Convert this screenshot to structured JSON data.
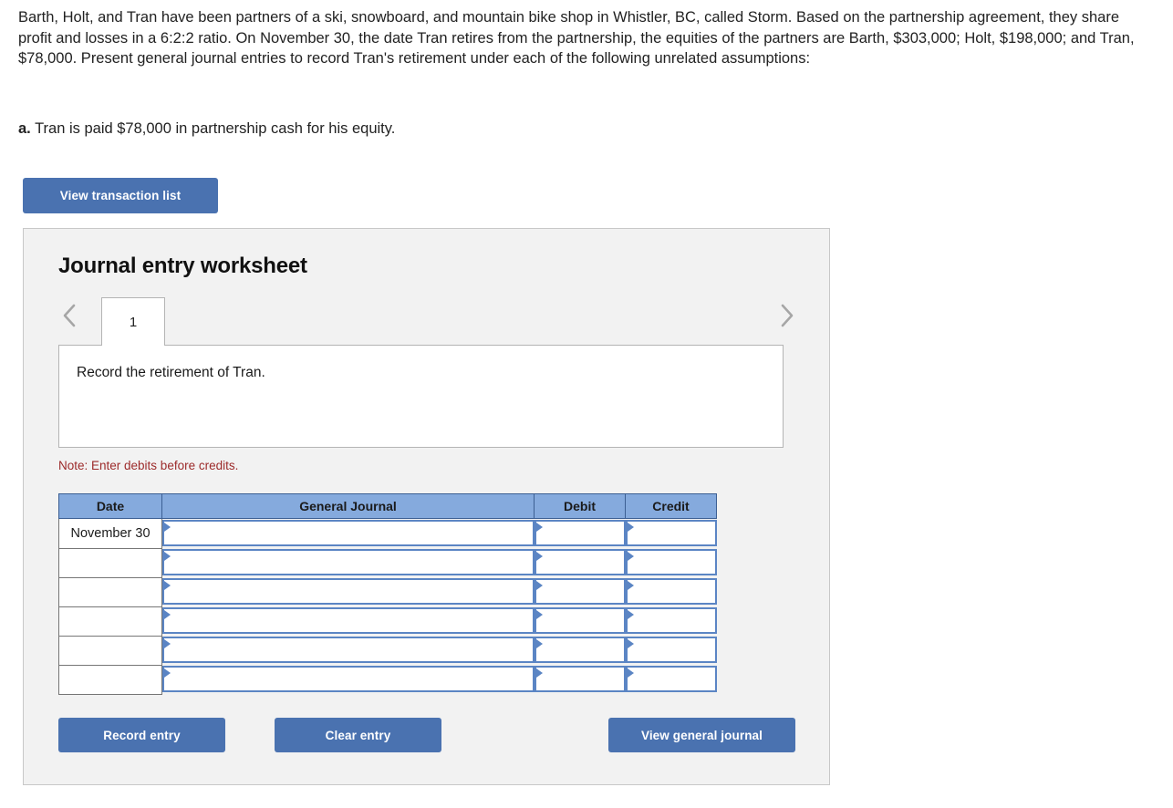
{
  "question": {
    "body": "Barth, Holt, and Tran have been partners of a ski, snowboard, and mountain bike shop in Whistler, BC, called Storm. Based on the partnership agreement, they share profit and losses in a 6:2:2 ratio. On November 30, the date Tran retires from the partnership, the equities of the partners are Barth, $303,000; Holt, $198,000; and Tran, $78,000. Present general journal entries to record Tran's retirement under each of the following unrelated assumptions:",
    "assumption_label": "a.",
    "assumption_text": "Tran is paid $78,000 in partnership cash for his equity."
  },
  "toolbar": {
    "view_transaction_list_label": "View transaction list"
  },
  "worksheet": {
    "title": "Journal entry worksheet",
    "prev_icon": "chevron-left-icon",
    "next_icon": "chevron-right-icon",
    "tabs": [
      {
        "label": "1",
        "active": true
      }
    ],
    "description": "Record the retirement of Tran.",
    "note": "Note: Enter debits before credits.",
    "table": {
      "headers": [
        "Date",
        "General Journal",
        "Debit",
        "Credit"
      ],
      "rows": [
        {
          "date": "November 30",
          "general_journal": "",
          "debit": "",
          "credit": ""
        },
        {
          "date": "",
          "general_journal": "",
          "debit": "",
          "credit": ""
        },
        {
          "date": "",
          "general_journal": "",
          "debit": "",
          "credit": ""
        },
        {
          "date": "",
          "general_journal": "",
          "debit": "",
          "credit": ""
        },
        {
          "date": "",
          "general_journal": "",
          "debit": "",
          "credit": ""
        },
        {
          "date": "",
          "general_journal": "",
          "debit": "",
          "credit": ""
        }
      ]
    },
    "actions": {
      "record_entry_label": "Record entry",
      "clear_entry_label": "Clear entry",
      "view_general_journal_label": "View general journal"
    }
  },
  "colors": {
    "button_blue": "#4a72b0",
    "header_blue": "#85aadd",
    "input_border_blue": "#5b85c4",
    "note_red": "#9c2a2a",
    "panel_background": "#f2f2f2"
  }
}
